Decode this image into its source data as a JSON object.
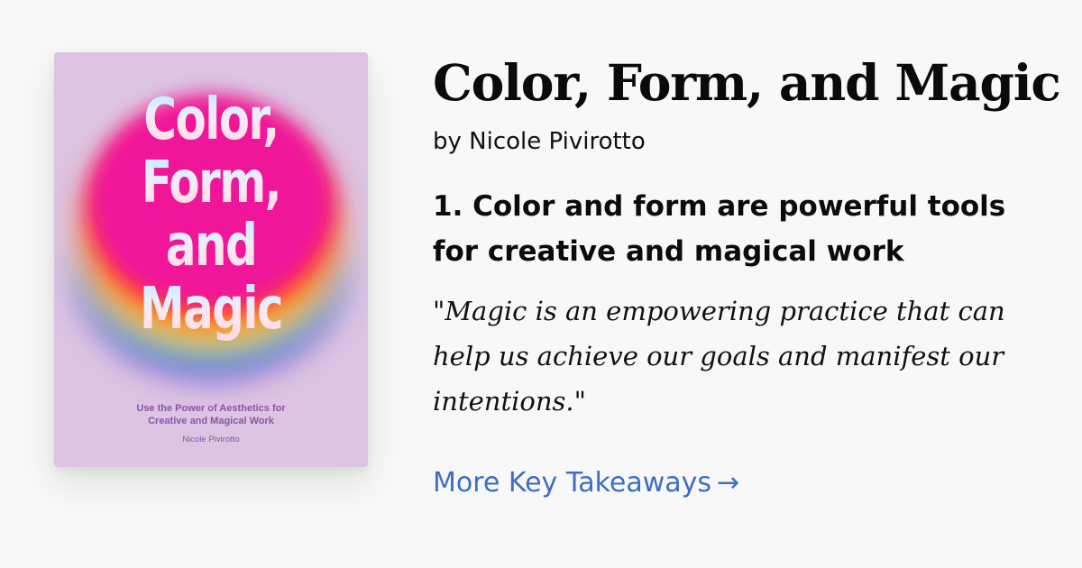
{
  "book": {
    "title": "Color, Form, and Magic",
    "author_line": "by Nicole Pivirotto"
  },
  "cover": {
    "title_lines": [
      "Color,",
      "Form,",
      "and",
      "Magic"
    ],
    "subtitle_line1": "Use the Power of Aesthetics for",
    "subtitle_line2": "Creative and Magical Work",
    "author": "Nicole Pivirotto",
    "background_color": "#dcc4e2",
    "accent_color": "#8a55a8"
  },
  "takeaway": {
    "heading": "1. Color and form are powerful tools for creative and magical work",
    "quote": "\"Magic is an empowering practice that can help us achieve our goals and manifest our intentions.\""
  },
  "links": {
    "more_takeaways_label": "More Key Takeaways",
    "arrow": "→",
    "link_color": "#3d6ec3"
  }
}
